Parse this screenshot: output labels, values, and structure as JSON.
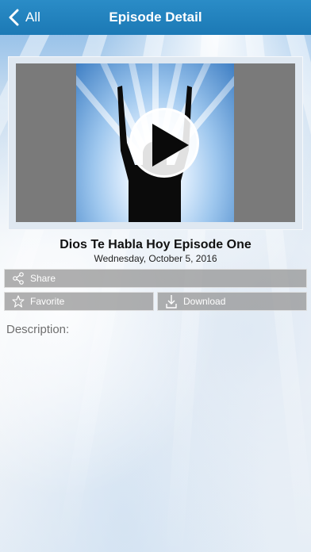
{
  "header": {
    "back_label": "All",
    "title": "Episode Detail",
    "background": "#1f7fbd"
  },
  "media": {
    "play_icon": "play-icon"
  },
  "episode": {
    "title": "Dios Te Habla Hoy Episode One",
    "date": "Wednesday, October 5, 2016"
  },
  "actions": {
    "share_label": "Share",
    "favorite_label": "Favorite",
    "download_label": "Download"
  },
  "description": {
    "label": "Description:"
  }
}
